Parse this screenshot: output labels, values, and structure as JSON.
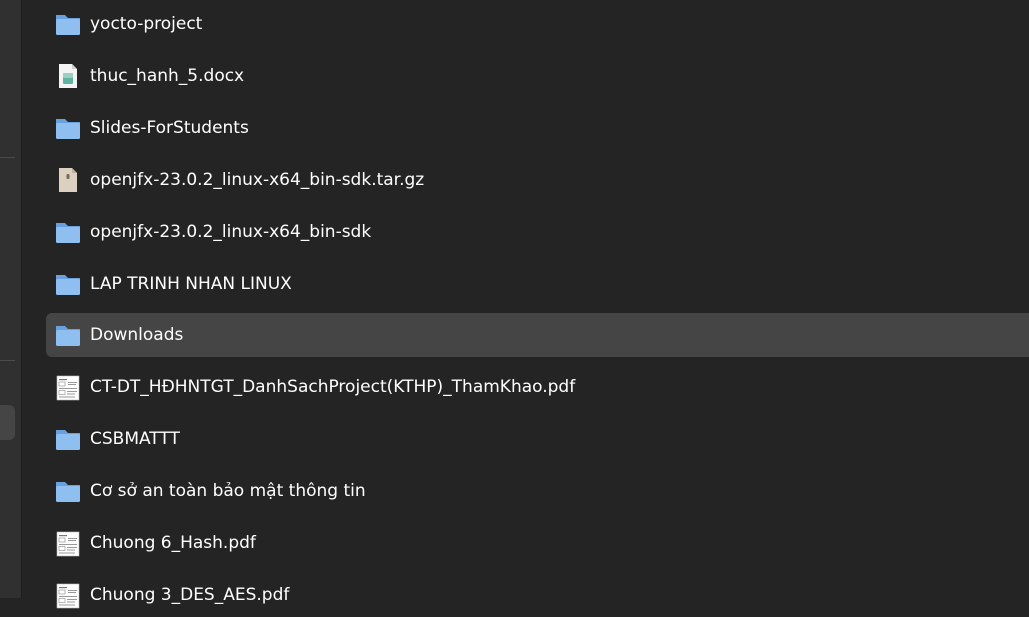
{
  "files": [
    {
      "name": "yocto-project",
      "icon": "folder-icon"
    },
    {
      "name": "thuc_hanh_5.docx",
      "icon": "document-icon"
    },
    {
      "name": "Slides-ForStudents",
      "icon": "folder-icon"
    },
    {
      "name": "openjfx-23.0.2_linux-x64_bin-sdk.tar.gz",
      "icon": "archive-icon"
    },
    {
      "name": "openjfx-23.0.2_linux-x64_bin-sdk",
      "icon": "folder-icon"
    },
    {
      "name": "LAP TRINH NHAN LINUX",
      "icon": "folder-icon"
    },
    {
      "name": "Downloads",
      "icon": "folder-icon",
      "selected": true
    },
    {
      "name": "CT-DT_HĐHNTGT_DanhSachProject(KTHP)_ThamKhao.pdf",
      "icon": "pdf-thumbnail-icon"
    },
    {
      "name": "CSBMATTT",
      "icon": "folder-icon"
    },
    {
      "name": "Cơ sở an toàn bảo mật thông tin",
      "icon": "folder-icon"
    },
    {
      "name": "Chuong 6_Hash.pdf",
      "icon": "pdf-thumbnail-icon"
    },
    {
      "name": "Chuong 3_DES_AES.pdf",
      "icon": "pdf-thumbnail-icon"
    }
  ],
  "colors": {
    "folder": "#8fbff0",
    "folder_tab": "#6aa0dd",
    "selected_row": "#454545",
    "background": "#242424"
  }
}
